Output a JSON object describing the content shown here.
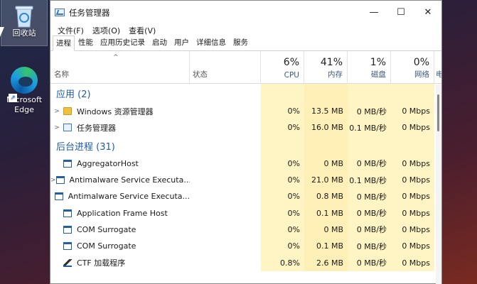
{
  "desktop": {
    "recycle_bin_label": "回收站",
    "edge_label_1": "Microsoft",
    "edge_label_2": "Edge"
  },
  "window": {
    "title": "任务管理器",
    "controls": {
      "minimize": "—",
      "maximize": "☐",
      "close": "✕"
    }
  },
  "menu": [
    "文件(F)",
    "选项(O)",
    "查看(V)"
  ],
  "tabs": [
    "进程",
    "性能",
    "应用历史记录",
    "启动",
    "用户",
    "详细信息",
    "服务"
  ],
  "header": {
    "name": "名称",
    "status": "状态",
    "cpu_pct": "6%",
    "cpu": "CPU",
    "mem_pct": "41%",
    "mem": "内存",
    "disk_pct": "1%",
    "disk": "磁盘",
    "net_pct": "0%",
    "net": "网络",
    "power": "电"
  },
  "groups": {
    "apps": "应用 (2)",
    "background": "后台进程 (31)"
  },
  "apps": [
    {
      "name": "Windows 资源管理器",
      "cpu": "0%",
      "mem": "13.5 MB",
      "disk": "0 MB/秒",
      "net": "0 Mbps"
    },
    {
      "name": "任务管理器",
      "cpu": "0%",
      "mem": "16.0 MB",
      "disk": "0.1 MB/秒",
      "net": "0 Mbps"
    }
  ],
  "background": [
    {
      "name": "AggregatorHost",
      "cpu": "0%",
      "mem": "0 MB",
      "disk": "0 MB/秒",
      "net": "0 Mbps"
    },
    {
      "name": "Antimalware Service Executa...",
      "cpu": "0%",
      "mem": "21.0 MB",
      "disk": "0.1 MB/秒",
      "net": "0 Mbps"
    },
    {
      "name": "Antimalware Service Executa...",
      "cpu": "0%",
      "mem": "0.8 MB",
      "disk": "0 MB/秒",
      "net": "0 Mbps"
    },
    {
      "name": "Application Frame Host",
      "cpu": "0%",
      "mem": "0.1 MB",
      "disk": "0 MB/秒",
      "net": "0 Mbps"
    },
    {
      "name": "COM Surrogate",
      "cpu": "0%",
      "mem": "0 MB",
      "disk": "0 MB/秒",
      "net": "0 Mbps"
    },
    {
      "name": "COM Surrogate",
      "cpu": "0%",
      "mem": "0.1 MB",
      "disk": "0 MB/秒",
      "net": "0 Mbps"
    },
    {
      "name": "CTF 加载程序",
      "cpu": "0.8%",
      "mem": "2.6 MB",
      "disk": "0 MB/秒",
      "net": "0 Mbps"
    }
  ]
}
